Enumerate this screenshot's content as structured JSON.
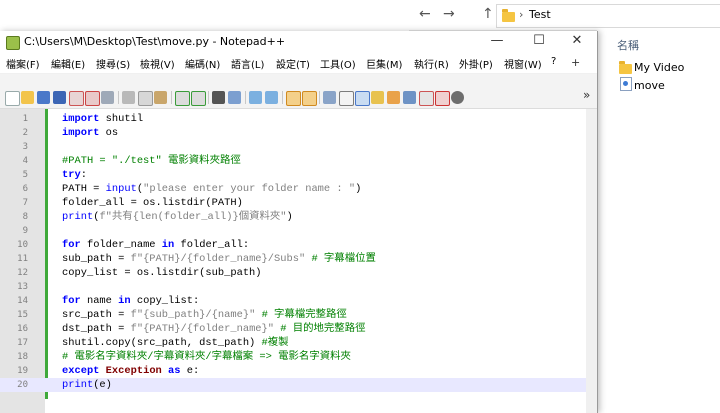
{
  "explorer": {
    "nav": {
      "back": "←",
      "forward": "→",
      "up": "↑"
    },
    "breadcrumb_sep": "›",
    "breadcrumb": "Test",
    "column_header": "名稱",
    "items": [
      "My Video",
      "move"
    ]
  },
  "window": {
    "title": "C:\\Users\\M\\Desktop\\Test\\move.py - Notepad++",
    "minimize": "—",
    "maximize": "☐",
    "close": "✕"
  },
  "menu": {
    "items": [
      "檔案(F)",
      "編輯(E)",
      "搜尋(S)",
      "檢視(V)",
      "編碼(N)",
      "語言(L)",
      "設定(T)",
      "工具(O)",
      "巨集(M)",
      "執行(R)",
      "外掛(P)",
      "視窗(W)",
      "?"
    ],
    "plus": "+",
    "dropdown": "▼",
    "close_tab": "X",
    "chevron": "»"
  },
  "code": {
    "line_numbers": [
      "1",
      "2",
      "3",
      "4",
      "5",
      "6",
      "7",
      "8",
      "9",
      "10",
      "11",
      "12",
      "13",
      "14",
      "15",
      "16",
      "17",
      "18",
      "19",
      "20"
    ],
    "current_line": 20,
    "lines": [
      "import shutil",
      "import os",
      "",
      "#PATH = \"./test\" 電影資料夾路徑",
      "try:",
      "PATH = input(\"please enter your folder name : \")",
      "folder_all = os.listdir(PATH)",
      "print(f\"共有{len(folder_all)}個資料夾\")",
      "",
      "for folder_name in folder_all:",
      "sub_path = f\"{PATH}/{folder_name}/Subs\" # 字幕檔位置",
      "copy_list = os.listdir(sub_path)",
      "",
      "for name in copy_list:",
      "src_path = f\"{sub_path}/{name}\" # 字幕檔完整路徑",
      "dst_path = f\"{PATH}/{folder_name}\" # 目的地完整路徑",
      "shutil.copy(src_path, dst_path) #複製",
      "# 電影名字資料夾/字幕資料夾/字幕檔案 => 電影名字資料夾",
      "except Exception as e:",
      "print(e)"
    ]
  },
  "colors": {
    "keyword": "#0000ff",
    "comment": "#008000",
    "string": "#808080",
    "current_line": "#e8e8ff",
    "change_bar": "#3fa93a"
  }
}
